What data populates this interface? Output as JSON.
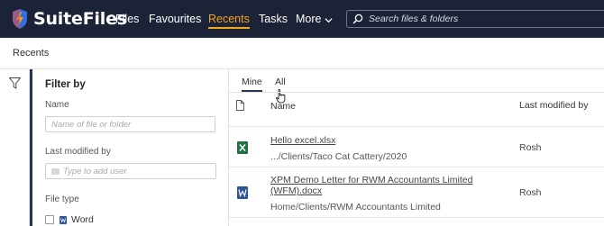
{
  "app": {
    "name": "SuiteFiles"
  },
  "nav": {
    "items": [
      {
        "label": "Files"
      },
      {
        "label": "Favourites"
      },
      {
        "label": "Recents"
      },
      {
        "label": "Tasks"
      },
      {
        "label": "More"
      }
    ],
    "active": "Recents"
  },
  "search": {
    "placeholder": "Search files & folders"
  },
  "breadcrumb": "Recents",
  "filter": {
    "title": "Filter by",
    "name_label": "Name",
    "name_placeholder": "Name of file or folder",
    "modified_label": "Last modified by",
    "modified_placeholder": "Type to add user",
    "type_label": "File type",
    "types": [
      {
        "label": "Word",
        "checked": false
      }
    ]
  },
  "tabs": [
    {
      "label": "Mine"
    },
    {
      "label": "All"
    }
  ],
  "active_tab": "Mine",
  "table": {
    "headers": {
      "name": "Name",
      "modified": "Last modified by"
    },
    "rows": [
      {
        "type": "excel",
        "name": "Hello excel.xlsx",
        "path": ".../Clients/Taco Cat Cattery/2020",
        "modified_by": "Rosh"
      },
      {
        "type": "word",
        "name": "XPM Demo Letter for RWM Accountants Limited (WFM).docx",
        "path": "Home/Clients/RWM Accountants Limited",
        "modified_by": "Rosh"
      }
    ]
  },
  "colors": {
    "topbar": "#1c2337",
    "accent": "#f5a623",
    "excel": "#217346",
    "word": "#2b579a"
  },
  "icons": [
    "logo-icon",
    "chevron-down-icon",
    "search-icon",
    "filter-icon",
    "user-icon",
    "word-icon",
    "file-icon",
    "excel-icon",
    "pointer-cursor-icon"
  ]
}
